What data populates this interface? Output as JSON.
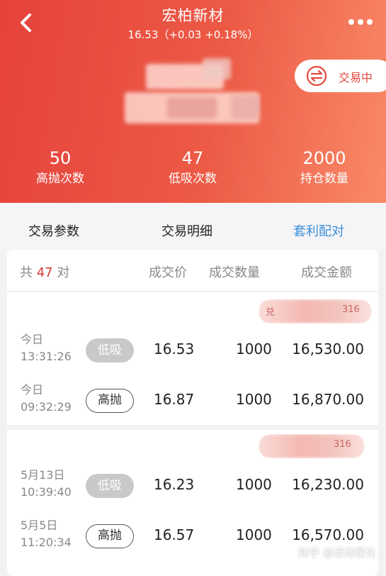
{
  "header": {
    "title": "宏柏新材",
    "subtitle": "16.53（+0.03 +0.18%）",
    "status_label": "交易中",
    "stats": [
      {
        "value": "50",
        "label": "高抛次数"
      },
      {
        "value": "47",
        "label": "低吸次数"
      },
      {
        "value": "2000",
        "label": "持仓数量"
      }
    ]
  },
  "tabs": [
    {
      "label": "交易参数"
    },
    {
      "label": "交易明细"
    },
    {
      "label": "套利配对",
      "active": true
    }
  ],
  "table": {
    "count_prefix": "共",
    "count": "47",
    "count_suffix": "对",
    "headers": [
      "成交价",
      "成交数量",
      "成交金额"
    ],
    "groups": [
      {
        "tag_visible": "兑 … 316",
        "rows": [
          {
            "date": "今日",
            "time": "13:31:26",
            "type": "低吸",
            "price": "16.53",
            "qty": "1000",
            "amount": "16,530.00"
          },
          {
            "date": "今日",
            "time": "09:32:29",
            "type": "高抛",
            "price": "16.87",
            "qty": "1000",
            "amount": "16,870.00"
          }
        ]
      },
      {
        "tag_visible": "316",
        "rows": [
          {
            "date": "5月13日",
            "time": "10:39:40",
            "type": "低吸",
            "price": "16.23",
            "qty": "1000",
            "amount": "16,230.00"
          },
          {
            "date": "5月5日",
            "time": "11:20:34",
            "type": "高抛",
            "price": "16.57",
            "qty": "1000",
            "amount": "16,570.00"
          }
        ]
      }
    ]
  },
  "watermark": "知乎 @迅动量化",
  "colors": {
    "header_start": "#e5423c",
    "header_end": "#f98a68",
    "accent_blue": "#3a8fd9",
    "count_red": "#d23a33"
  },
  "icons": {
    "back": "chevron-left-icon",
    "more": "more-dots-icon",
    "status": "exchange-icon"
  }
}
